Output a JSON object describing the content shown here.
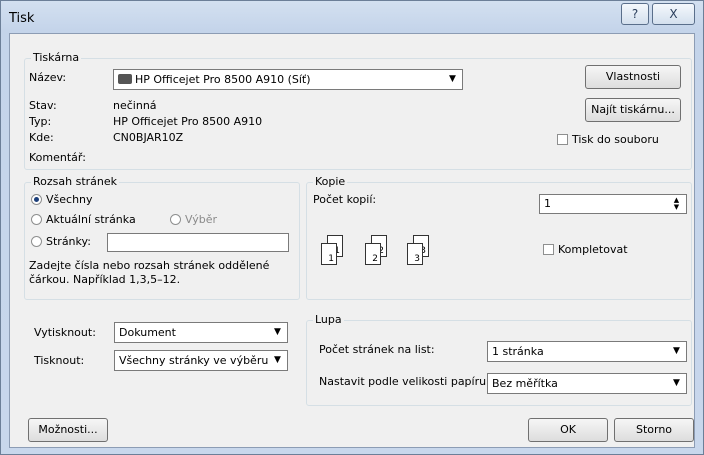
{
  "window": {
    "title": "Tisk",
    "help_label": "?",
    "close_label": "X"
  },
  "printer": {
    "group_label": "Tiskárna",
    "name_label": "Název:",
    "name_value": "HP Officejet Pro 8500 A910 (Síť)",
    "properties_button": "Vlastnosti",
    "find_button": "Najít tiskárnu...",
    "status_label": "Stav:",
    "status_value": "nečinná",
    "type_label": "Typ:",
    "type_value": "HP Officejet Pro 8500 A910",
    "where_label": "Kde:",
    "where_value": "CN0BJAR10Z",
    "comment_label": "Komentář:",
    "print_to_file_label": "Tisk do souboru"
  },
  "range": {
    "group_label": "Rozsah stránek",
    "all_label": "Všechny",
    "current_label": "Aktuální stránka",
    "selection_label": "Výběr",
    "pages_label": "Stránky:",
    "pages_value": "",
    "hint": "Zadejte čísla nebo rozsah stránek oddělené čárkou. Například 1,3,5–12."
  },
  "copies": {
    "group_label": "Kopie",
    "count_label": "Počet kopií:",
    "count_value": "1",
    "collate_label": "Kompletovat",
    "page_numbers": [
      "1",
      "1",
      "2",
      "2",
      "3",
      "3"
    ]
  },
  "output": {
    "print_what_label": "Vytisknout:",
    "print_what_value": "Dokument",
    "print_label": "Tisknout:",
    "print_value": "Všechny stránky ve výběru"
  },
  "zoom": {
    "group_label": "Lupa",
    "pages_per_sheet_label": "Počet stránek na list:",
    "pages_per_sheet_value": "1 stránka",
    "scale_label": "Nastavit podle velikosti papíru:",
    "scale_value": "Bez měřítka"
  },
  "footer": {
    "options_button": "Možnosti...",
    "ok_button": "OK",
    "cancel_button": "Storno"
  },
  "icons": {
    "printer": "printer-icon",
    "dropdown": "chevron-down-icon",
    "spin": "spin-arrows-icon"
  }
}
